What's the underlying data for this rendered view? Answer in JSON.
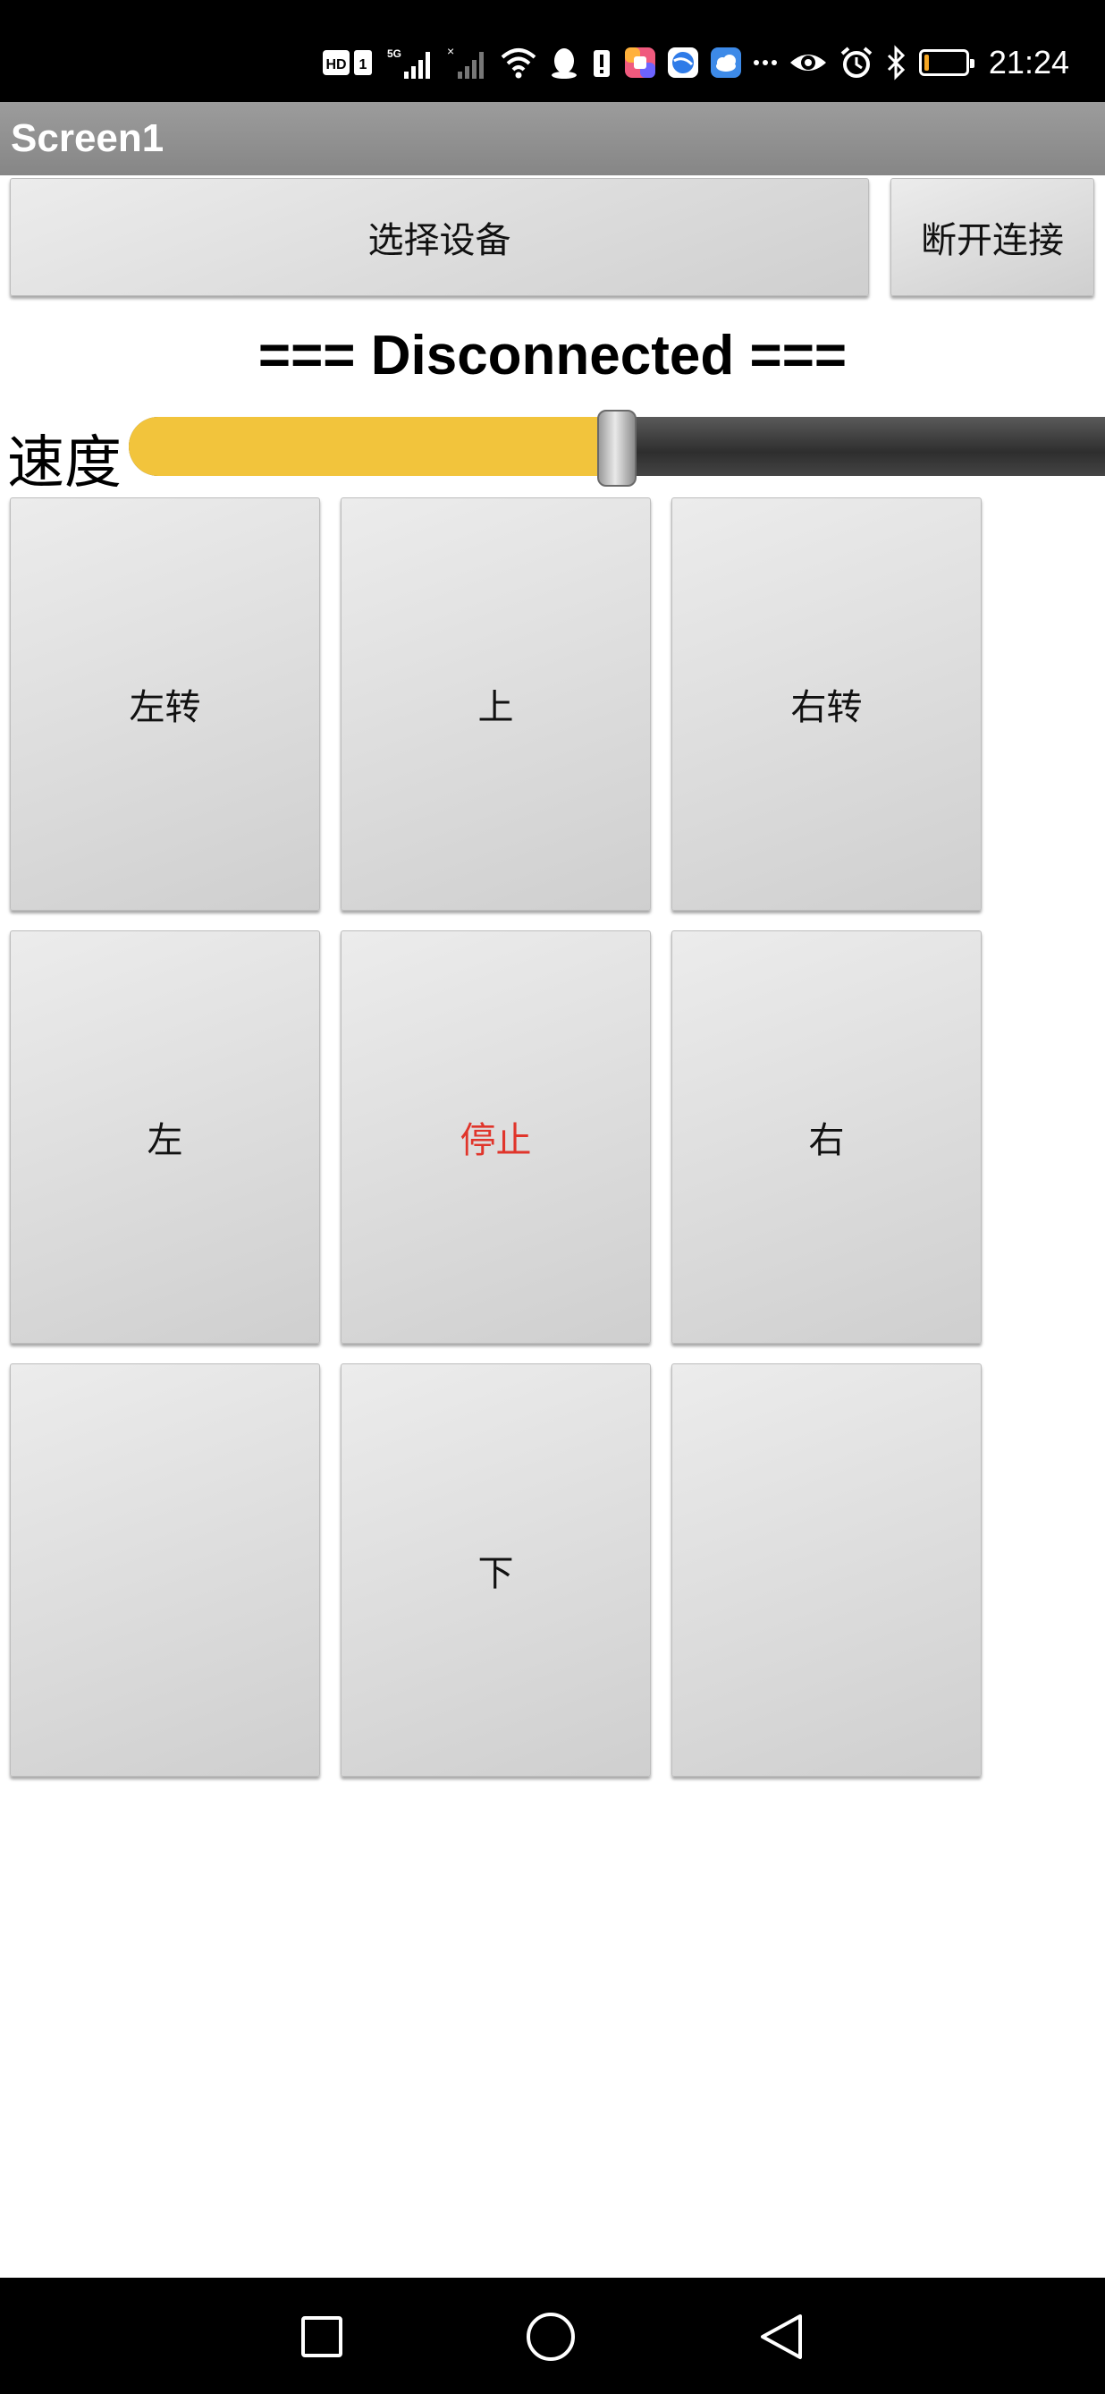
{
  "status_bar": {
    "time": "21:24",
    "battery_level": 0.12,
    "icons": [
      "hd-icon",
      "sim-icon",
      "signal-5g-icon",
      "signal-icon",
      "wifi-icon",
      "qq-icon",
      "notification-icon",
      "app-icon",
      "browser-icon",
      "weather-icon",
      "more-icon",
      "eye-icon",
      "alarm-icon",
      "bluetooth-icon",
      "battery-icon"
    ]
  },
  "app": {
    "title": "Screen1"
  },
  "toolbar": {
    "select_device": "选择设备",
    "disconnect": "断开连接"
  },
  "connection": {
    "status": "=== Disconnected ==="
  },
  "speed": {
    "label": "速度",
    "value": 0.5,
    "fill_color": "#f2c43c"
  },
  "controls": {
    "turn_left": "左转",
    "up": "上",
    "turn_right": "右转",
    "left": "左",
    "stop": "停止",
    "right": "右",
    "blank_left": "",
    "down": "下",
    "blank_right": "",
    "stop_color": "#e0352b"
  },
  "navigation": {
    "icons": [
      "recents-icon",
      "home-icon",
      "back-icon"
    ]
  }
}
